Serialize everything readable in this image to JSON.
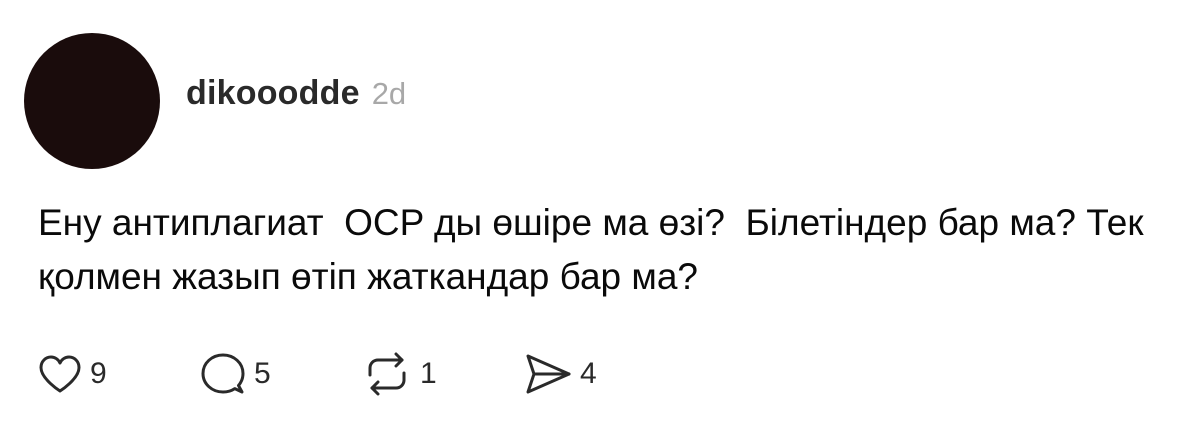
{
  "post": {
    "username": "dikooodde",
    "timestamp": "2d",
    "text": "Ену антиплагиат  OCP ды өшіре ма өзі?  Білетіндер бар ма? Тек қолмен жазып өтіп жаткандар бар ма?",
    "avatar_color": "#1a0c0c"
  },
  "actions": {
    "like": {
      "icon": "heart-icon",
      "count": "9"
    },
    "comment": {
      "icon": "comment-bubble-icon",
      "count": "5"
    },
    "repost": {
      "icon": "repost-icon",
      "count": "1"
    },
    "share": {
      "icon": "send-icon",
      "count": "4"
    }
  }
}
